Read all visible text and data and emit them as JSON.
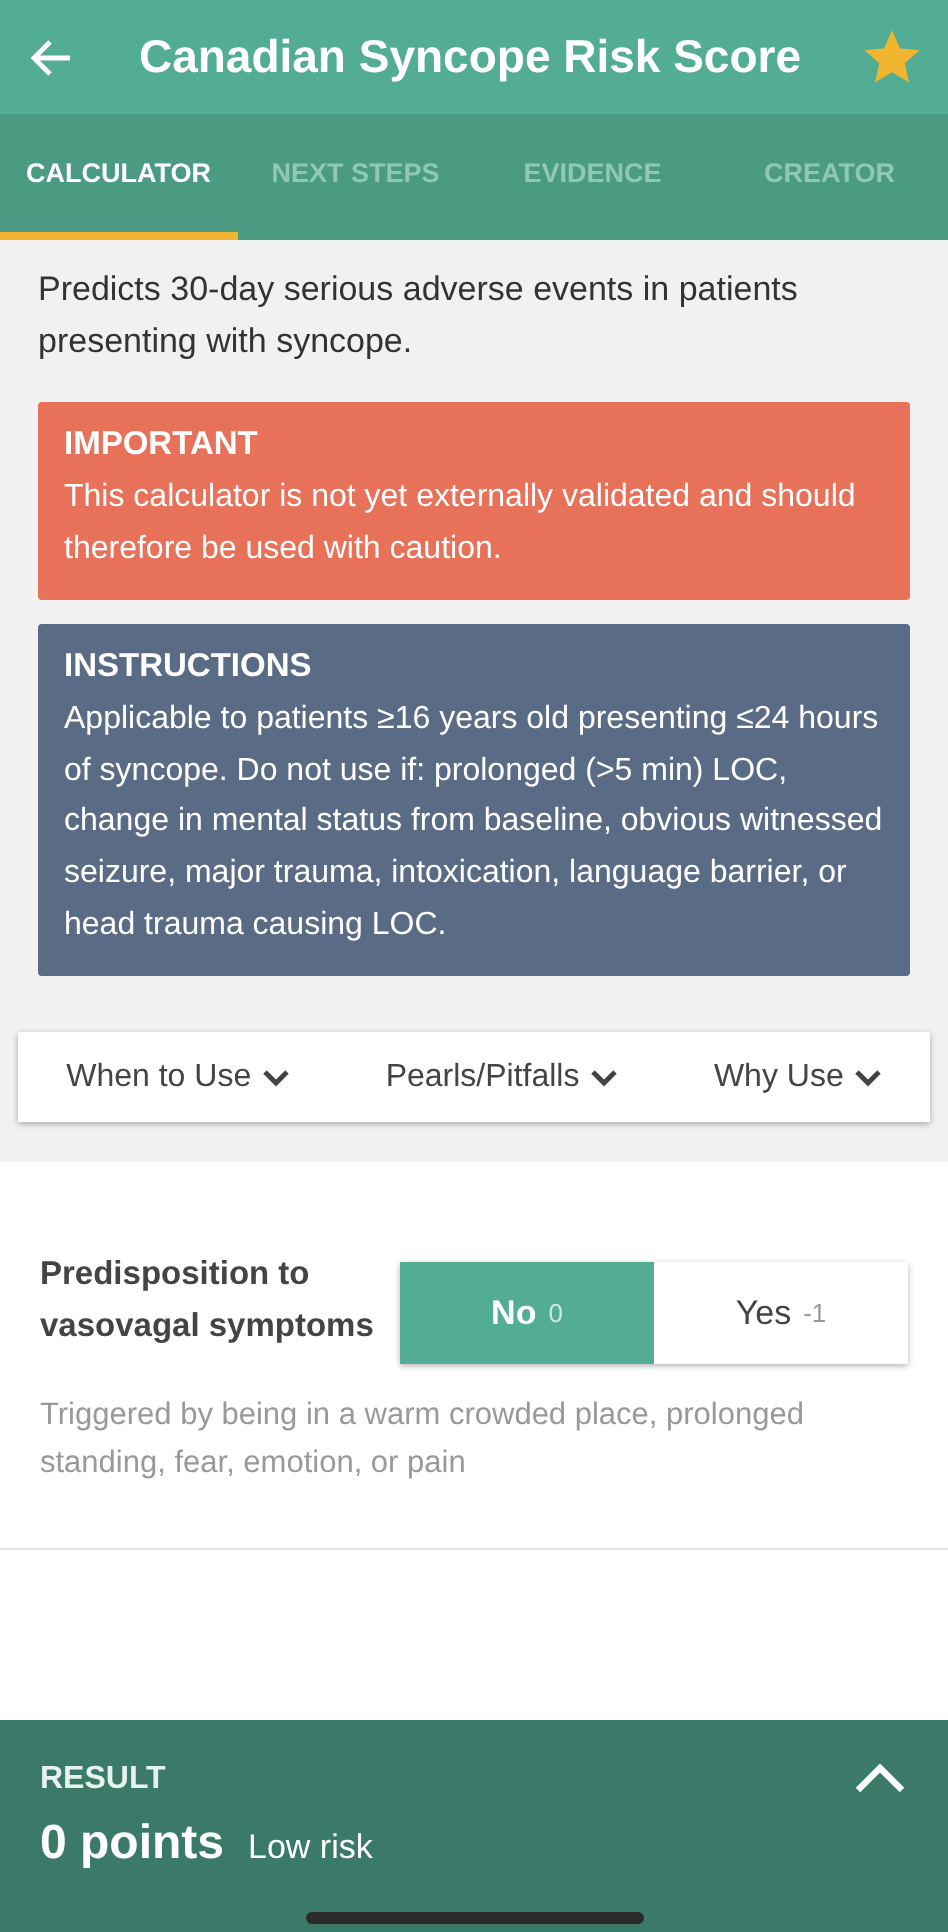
{
  "header": {
    "title": "Canadian Syncope Risk Score",
    "favorite": true
  },
  "tabs": [
    {
      "label": "CALCULATOR",
      "selected": true
    },
    {
      "label": "NEXT STEPS",
      "selected": false
    },
    {
      "label": "EVIDENCE",
      "selected": false
    },
    {
      "label": "CREATOR",
      "selected": false
    }
  ],
  "description": "Predicts 30-day serious adverse events in patients presenting with syncope.",
  "notices": [
    {
      "kind": "warning",
      "title": "IMPORTANT",
      "text": "This calculator is not yet externally validated and should therefore be used with caution."
    },
    {
      "kind": "info",
      "title": "INSTRUCTIONS",
      "text": "Applicable to patients ≥16 years old presenting ≤24 hours of syncope. Do not use if: prolonged (>5 min) LOC, change in mental status from baseline, obvious witnessed seizure, major trauma, intoxication, language barrier, or head trauma causing LOC."
    }
  ],
  "info_links": [
    {
      "label": "When to Use",
      "expanded": false
    },
    {
      "label": "Pearls/Pitfalls",
      "expanded": false
    },
    {
      "label": "Why Use",
      "expanded": false
    }
  ],
  "questions": [
    {
      "label": "Predisposition to vasovagal symptoms",
      "hint": "Triggered by being in a warm crowded place, prolonged standing, fear, emotion, or pain",
      "options": [
        {
          "label": "No",
          "points": "0",
          "selected": true
        },
        {
          "label": "Yes",
          "points": "-1",
          "selected": false
        }
      ]
    }
  ],
  "result": {
    "title": "RESULT",
    "expanded": false,
    "score": "0 points",
    "interpretation": "Low risk"
  }
}
